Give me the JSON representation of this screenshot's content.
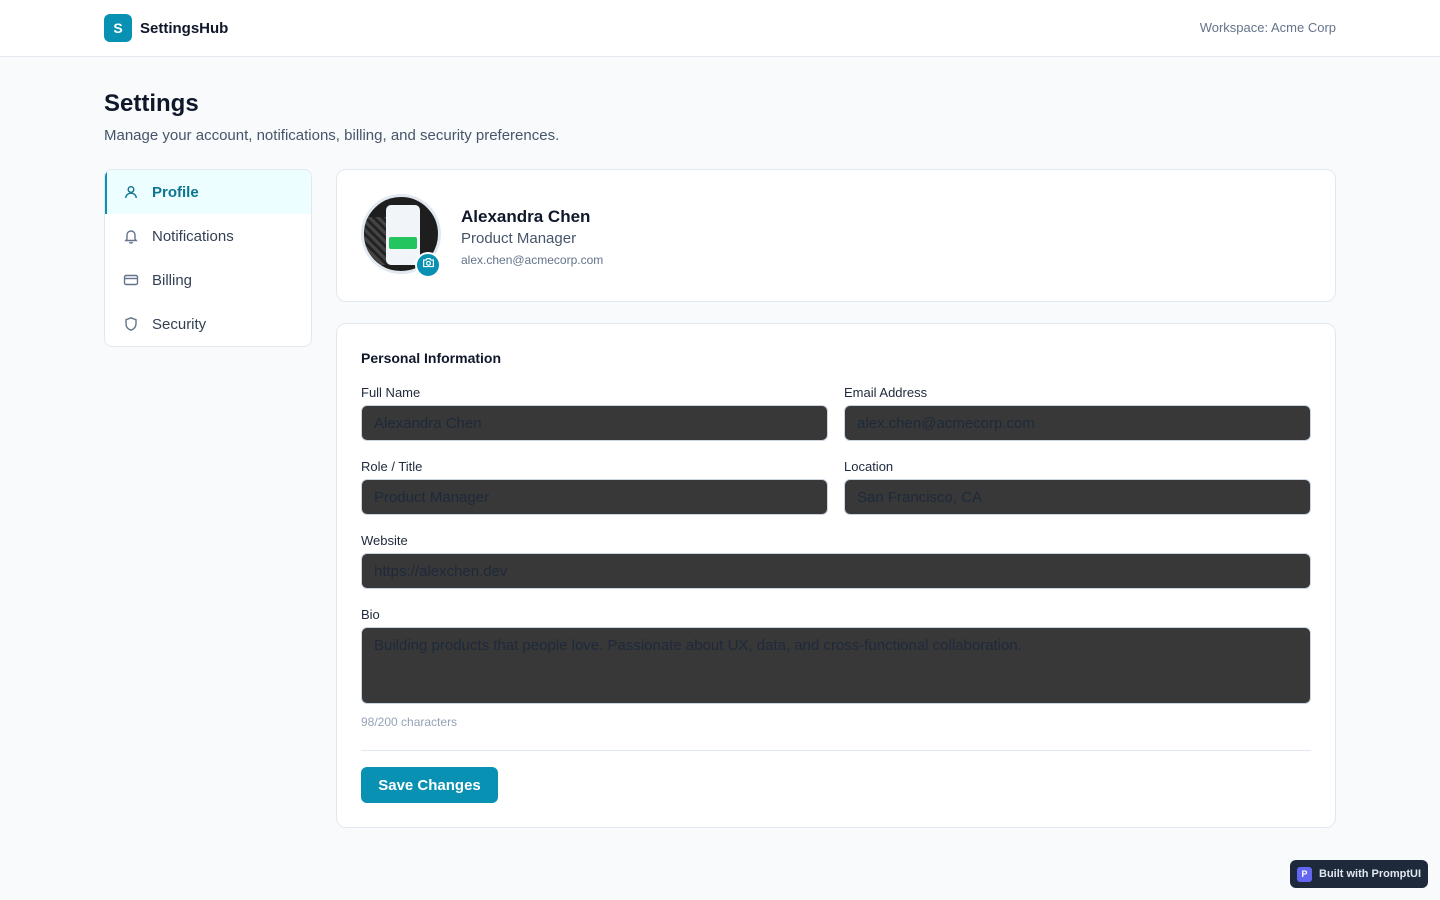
{
  "app": {
    "logo_letter": "S",
    "name": "SettingsHub",
    "workspace": "Workspace: Acme Corp"
  },
  "page": {
    "title": "Settings",
    "subtitle": "Manage your account, notifications, billing, and security preferences."
  },
  "sidebar": {
    "items": [
      {
        "label": "Profile",
        "icon": "user-icon",
        "active": true
      },
      {
        "label": "Notifications",
        "icon": "bell-icon",
        "active": false
      },
      {
        "label": "Billing",
        "icon": "credit-card-icon",
        "active": false
      },
      {
        "label": "Security",
        "icon": "shield-icon",
        "active": false
      }
    ]
  },
  "profile": {
    "name": "Alexandra Chen",
    "role": "Product Manager",
    "email": "alex.chen@acmecorp.com"
  },
  "form": {
    "section_title": "Personal Information",
    "full_name": {
      "label": "Full Name",
      "value": "Alexandra Chen"
    },
    "email": {
      "label": "Email Address",
      "value": "alex.chen@acmecorp.com"
    },
    "role": {
      "label": "Role / Title",
      "value": "Product Manager"
    },
    "location": {
      "label": "Location",
      "value": "San Francisco, CA"
    },
    "website": {
      "label": "Website",
      "value": "https://alexchen.dev"
    },
    "bio": {
      "label": "Bio",
      "value": "Building products that people love. Passionate about UX, data, and cross-functional collaboration."
    },
    "char_count": "98/200 characters",
    "save_label": "Save Changes"
  },
  "badge": {
    "logo_letter": "P",
    "text": "Built with PromptUI"
  },
  "colors": {
    "accent": "#0891b2",
    "active_bg": "#ecfeff",
    "input_bg": "#383838"
  }
}
